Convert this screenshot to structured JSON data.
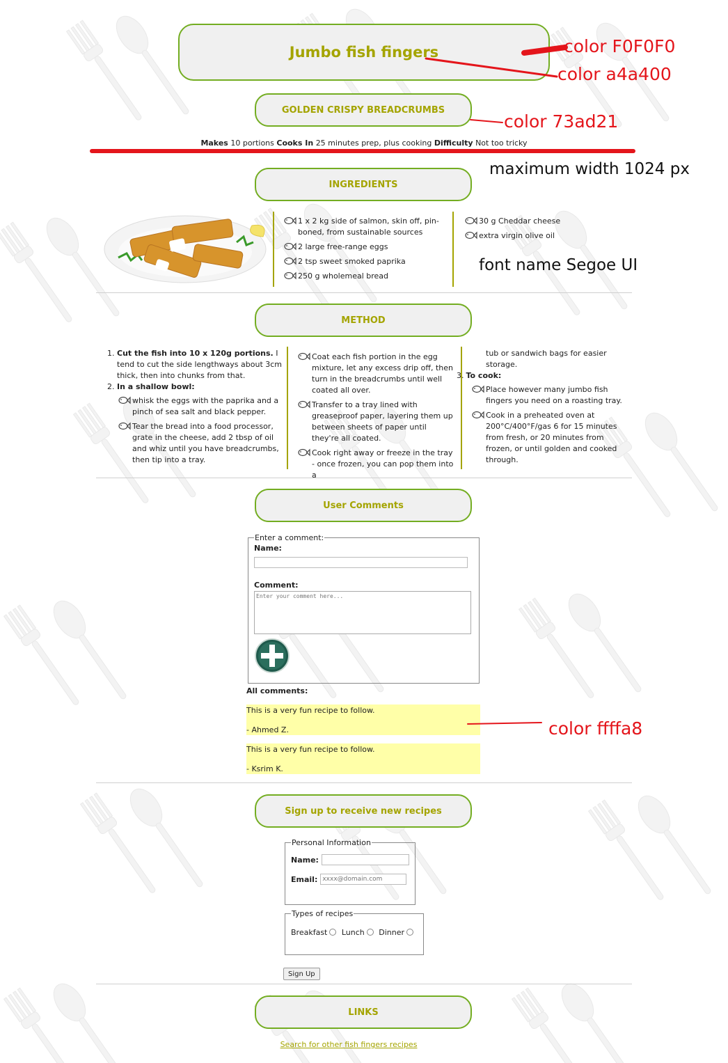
{
  "recipe": {
    "title": "Jumbo fish fingers",
    "subtitle": "GOLDEN CRISPY BREADCRUMBS",
    "meta": {
      "makes_label": "Makes",
      "makes_value": "10 portions",
      "cooks_label": "Cooks In",
      "cooks_value": "25 minutes prep, plus cooking",
      "difficulty_label": "Difficulty",
      "difficulty_value": "Not too tricky"
    }
  },
  "ingredients": {
    "heading": "INGREDIENTS",
    "col1": [
      "1 x 2 kg side of salmon, skin off, pin-boned, from sustainable sources",
      "2 large free-range eggs",
      "2 tsp sweet smoked paprika",
      "250 g wholemeal bread"
    ],
    "col2": [
      "30 g Cheddar cheese",
      "extra virgin olive oil"
    ]
  },
  "method": {
    "heading": "METHOD",
    "step1_bold": "Cut the fish into 10 x 120g portions.",
    "step1_text": " I tend to cut the side lengthways about 3cm thick, then into chunks from that.",
    "step2_bold": "In a shallow bowl:",
    "step2_items": [
      "whisk the eggs with the paprika and a pinch of sea salt and black pepper.",
      "Tear the bread into a food processor, grate in the cheese, add 2 tbsp of oil and whiz until you have breadcrumbs, then tip into a tray."
    ],
    "col2_items": [
      "Coat each fish portion in the egg mixture, let any excess drip off, then turn in the breadcrumbs until well coated all over.",
      "Transfer to a tray lined with greaseproof paper, layering them up between sheets of paper until they're all coated.",
      "Cook right away or freeze in the tray - once frozen, you can pop them into a"
    ],
    "col3_continuation": "tub or sandwich bags for easier storage.",
    "step3_bold": "To cook:",
    "step3_items": [
      "Place however many jumbo fish fingers you need on a roasting tray.",
      "Cook in a preheated oven at 200°C/400°F/gas 6 for 15 minutes from fresh, or 20 minutes from frozen, or until golden and cooked through."
    ]
  },
  "comments": {
    "heading": "User Comments",
    "legend": "Enter a comment:",
    "name_label": "Name:",
    "comment_label": "Comment:",
    "comment_placeholder": "Enter your comment here...",
    "all_label": "All comments:",
    "list": [
      {
        "text": "This is a very fun recipe to follow.",
        "author": "- Ahmed Z."
      },
      {
        "text": "This is a very fun recipe to follow.",
        "author": "- Ksrim K."
      }
    ]
  },
  "signup": {
    "heading": "Sign up to receive new recipes",
    "personal_legend": "Personal Information",
    "name_label": "Name:",
    "email_label": "Email:",
    "email_placeholder": "xxxx@domain.com",
    "types_legend": "Types of recipes",
    "options": [
      "Breakfast",
      "Lunch",
      "Dinner"
    ],
    "button": "Sign Up"
  },
  "links": {
    "heading": "LINKS",
    "link_text": "Search for other fish fingers recipes"
  },
  "annotations": {
    "bg_color": "color F0F0F0",
    "title_color": "color a4a400",
    "border_color": "color 73ad21",
    "max_width": "maximum width 1024 px",
    "font": "font name Segoe UI",
    "comment_color": "color ffffa8"
  },
  "colors": {
    "box_bg": "#F0F0F0",
    "title": "#a4a400",
    "border": "#73ad21",
    "comment_bg": "#ffffa8",
    "annotation": "#e4151b"
  }
}
